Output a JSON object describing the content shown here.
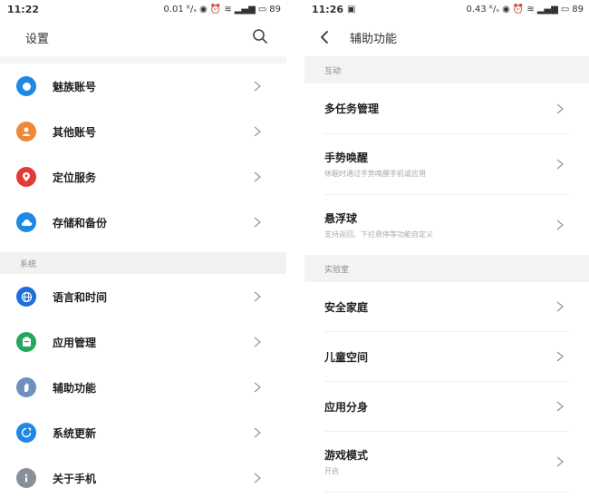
{
  "left": {
    "status": {
      "time": "11:22",
      "net": "0.01 ᴷ/ₛ",
      "battery": "89"
    },
    "title": "设置",
    "icons": {
      "search": "search-icon"
    },
    "sections": {
      "system": "系统"
    },
    "accounts": [
      {
        "label": "魅族账号",
        "icon": "meizu-account-icon",
        "color": "#1e88e5"
      },
      {
        "label": "其他账号",
        "icon": "person-icon",
        "color": "#f0883a"
      },
      {
        "label": "定位服务",
        "icon": "location-pin-icon",
        "color": "#e53935"
      },
      {
        "label": "存储和备份",
        "icon": "cloud-icon",
        "color": "#1e88e5"
      }
    ],
    "system_items": [
      {
        "label": "语言和时间",
        "icon": "globe-icon",
        "color": "#1e6fd9"
      },
      {
        "label": "应用管理",
        "icon": "app-manage-icon",
        "color": "#26a65b"
      },
      {
        "label": "辅助功能",
        "icon": "hand-icon",
        "color": "#6f8fbf"
      },
      {
        "label": "系统更新",
        "icon": "update-icon",
        "color": "#1e88e5"
      },
      {
        "label": "关于手机",
        "icon": "info-icon",
        "color": "#8a9099"
      }
    ]
  },
  "right": {
    "status": {
      "time": "11:26",
      "net": "0.43 ᴷ/ₛ",
      "battery": "89"
    },
    "title": "辅助功能",
    "sections": {
      "interaction": "互动",
      "lab": "实验室"
    },
    "interaction_items": [
      {
        "label": "多任务管理",
        "sub": ""
      },
      {
        "label": "手势唤醒",
        "sub": "休眠时通过手势唤醒手机或应用"
      },
      {
        "label": "悬浮球",
        "sub": "支持返回、下拉悬停等功能自定义"
      }
    ],
    "lab_items": [
      {
        "label": "安全家庭",
        "sub": ""
      },
      {
        "label": "儿童空间",
        "sub": ""
      },
      {
        "label": "应用分身",
        "sub": ""
      },
      {
        "label": "游戏模式",
        "sub": "开启"
      }
    ]
  }
}
